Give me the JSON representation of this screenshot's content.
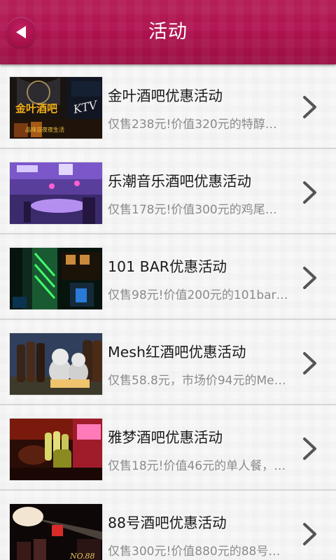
{
  "header": {
    "title": "活动",
    "back_icon": "arrow-left-icon"
  },
  "items": [
    {
      "title": "金叶酒吧优惠活动",
      "desc": "仅售238元!价值320元的特醇…",
      "chevron_icon": "chevron-right-icon",
      "image_text": [
        "金叶酒吧",
        "KTV",
        "品味滋夜夜生活"
      ]
    },
    {
      "title": "乐潮音乐酒吧优惠活动",
      "desc": "仅售178元!价值300元的鸡尾…",
      "chevron_icon": "chevron-right-icon"
    },
    {
      "title": "101 BAR优惠活动",
      "desc": "仅售98元!价值200元的101bar…",
      "chevron_icon": "chevron-right-icon"
    },
    {
      "title": "Mesh红酒吧优惠活动",
      "desc": "仅售58.8元，市场价94元的Me…",
      "chevron_icon": "chevron-right-icon"
    },
    {
      "title": "雅梦酒吧优惠活动",
      "desc": "仅售18元!价值46元的单人餐，…",
      "chevron_icon": "chevron-right-icon"
    },
    {
      "title": "88号酒吧优惠活动",
      "desc": "仅售300元!价值880元的88号…",
      "chevron_icon": "chevron-right-icon",
      "image_text": [
        "NO.88"
      ]
    }
  ],
  "colors": {
    "header": "#b0124f",
    "back_button": "#a30f48",
    "title_text": "#ffffff",
    "item_title": "#1a1a1a",
    "item_desc": "#8b8b8b",
    "divider": "#d6d6d6",
    "chevron": "#555555"
  }
}
